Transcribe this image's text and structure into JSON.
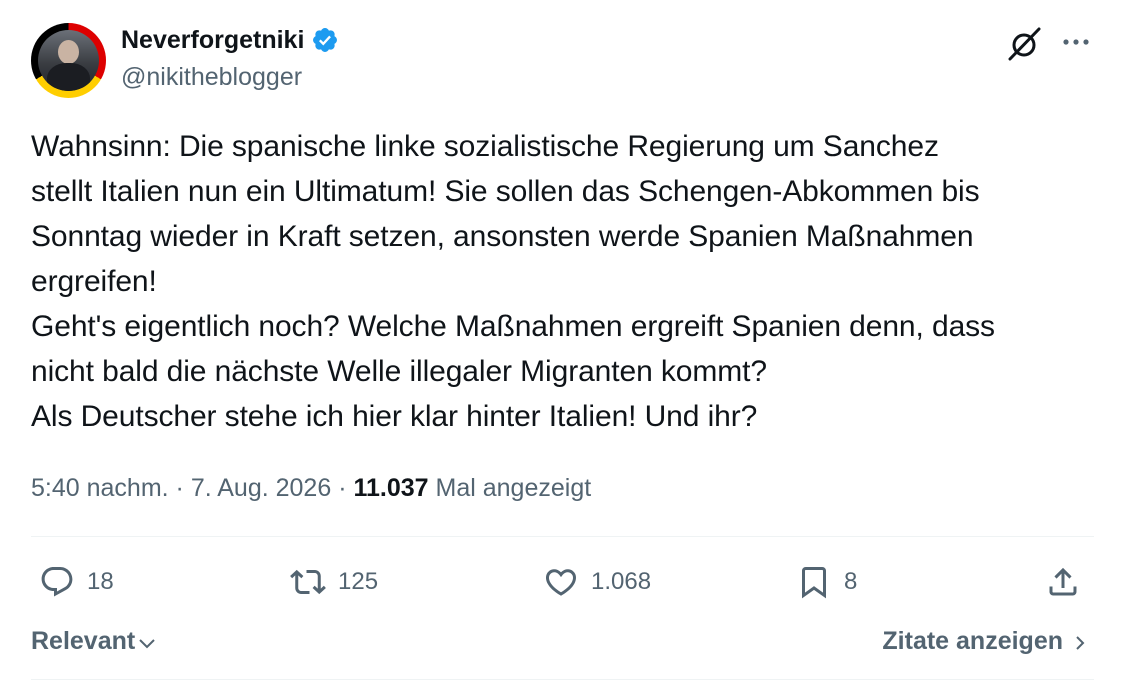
{
  "author": {
    "display_name": "Neverforgetniki",
    "handle": "@nikitheblogger",
    "verified": true,
    "avatar_icon": "profile-photo-with-german-flag-ring"
  },
  "header_icons": {
    "grok": "grok-icon",
    "more": "more-options-icon"
  },
  "tweet": {
    "text": "Wahnsinn: Die spanische linke sozialistische Regierung um Sanchez\nstellt Italien nun ein Ultimatum! Sie sollen das Schengen-Abkommen bis\nSonntag wieder in Kraft setzen, ansonsten werde Spanien Maßnahmen\nergreifen!\nGeht's eigentlich noch? Welche Maßnahmen ergreift Spanien denn, dass\nnicht bald die nächste Welle illegaler Migranten kommt?\nAls Deutscher stehe ich hier klar hinter Italien! Und ihr?"
  },
  "meta": {
    "time": "5:40 nachm.",
    "separator": "·",
    "date": "7. Aug. 2026",
    "views_count": "11.037",
    "views_label": "Mal angezeigt"
  },
  "actions": {
    "replies": "18",
    "reposts": "125",
    "likes": "1.068",
    "bookmarks": "8"
  },
  "footer": {
    "sort_label": "Relevant",
    "quotes_label": "Zitate anzeigen"
  },
  "colors": {
    "text": "#0f1419",
    "secondary": "#536471",
    "verified_blue": "#1d9bf0",
    "divider": "#eff3f4"
  }
}
